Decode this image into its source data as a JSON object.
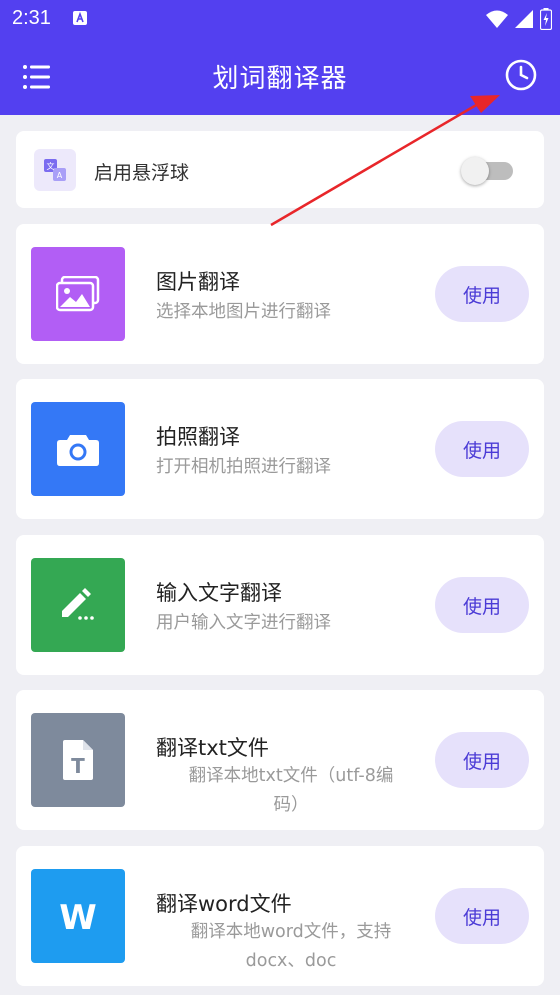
{
  "status_bar": {
    "time": "2:31"
  },
  "app_bar": {
    "title": "划词翻译器"
  },
  "float_ball": {
    "label": "启用悬浮球",
    "enabled": false
  },
  "features": [
    {
      "title": "图片翻译",
      "subtitle": "选择本地图片进行翻译",
      "button": "使用",
      "icon": "image-icon",
      "color": "#b25ef5"
    },
    {
      "title": "拍照翻译",
      "subtitle": "打开相机拍照进行翻译",
      "button": "使用",
      "icon": "camera-icon",
      "color": "#3478f6"
    },
    {
      "title": "输入文字翻译",
      "subtitle": "用户输入文字进行翻译",
      "button": "使用",
      "icon": "edit-icon",
      "color": "#34a853"
    },
    {
      "title": "翻译txt文件",
      "subtitle_lines": [
        "翻译本地txt文件（utf-8编",
        "码）"
      ],
      "button": "使用",
      "icon": "text-file-icon",
      "color": "#7e8a9c"
    },
    {
      "title": "翻译word文件",
      "subtitle_lines": [
        "翻译本地word文件，支持",
        "docx、doc"
      ],
      "button": "使用",
      "icon": "word-icon",
      "color": "#1e9cf0"
    }
  ],
  "colors": {
    "accent": "#5340f0",
    "annotation": "#e8262a"
  }
}
